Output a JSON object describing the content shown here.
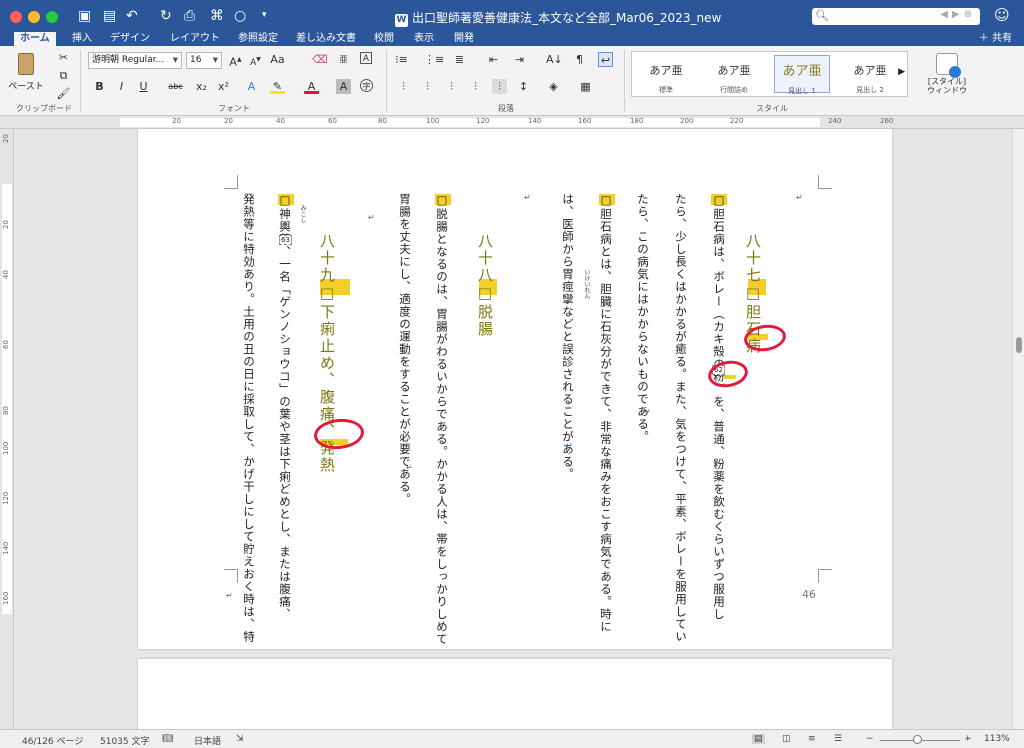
{
  "window": {
    "title": "出口聖師著愛善健康法_本文など全部_Mar06_2023_new",
    "search_placeholder": ""
  },
  "tabs": [
    "ホーム",
    "挿入",
    "デザイン",
    "レイアウト",
    "参照設定",
    "差し込み文書",
    "校閲",
    "表示",
    "開発"
  ],
  "share_label": "共有",
  "ribbon": {
    "clipboard": {
      "paste": "ペースト",
      "group": "クリップボード"
    },
    "font": {
      "name": "游明朝 Regular...",
      "size": "16",
      "group": "フォント"
    },
    "paragraph": {
      "group": "段落"
    },
    "styles": {
      "group": "スタイル",
      "items": [
        {
          "preview": "あア亜",
          "name": "標準"
        },
        {
          "preview": "あア亜",
          "name": "行間詰め"
        },
        {
          "preview": "あア亜",
          "name": "見出し 1"
        },
        {
          "preview": "あア亜",
          "name": "見出し 2"
        }
      ],
      "pane_button": "[スタイル]\nウィンドウ"
    }
  },
  "ruler": {
    "h_labels": [
      "20",
      "20",
      "40",
      "60",
      "80",
      "100",
      "120",
      "140",
      "160",
      "180",
      "200",
      "220",
      "240",
      "260"
    ],
    "v_labels": [
      "20",
      "20",
      "40",
      "60",
      "80",
      "100",
      "120",
      "140",
      "160"
    ]
  },
  "page": {
    "number": "46",
    "columns": [
      {
        "id": "h87",
        "text": "八十七□胆石病",
        "type": "heading"
      },
      {
        "id": "c1",
        "text": "□胆石病は、ボレー（カキ殻の粉）を、普通、粉薬を飲むくらいずつ服用し",
        "type": "body"
      },
      {
        "id": "c2",
        "text": "たら、少し長くはかかるが癒る。また、気をつけて、平素、ボレーを服用してい",
        "type": "body"
      },
      {
        "id": "c3",
        "text": "たら、この病気にはかからないものである。",
        "type": "body"
      },
      {
        "id": "c4",
        "text": "□胆石病とは、胆臓に石灰分ができて、非常な痛みをおこす病気である。時に",
        "type": "body"
      },
      {
        "id": "c5",
        "text": "は、医師から胃痙攣などと誤診されることがある。",
        "type": "body"
      },
      {
        "id": "h88",
        "text": "八十八□脱腸",
        "type": "heading"
      },
      {
        "id": "c6",
        "text": "□脱腸となるのは、胃腸がわるいからである。かかる人は、帯をしっかりしめて",
        "type": "body"
      },
      {
        "id": "c7",
        "text": "胃腸を丈夫にし、適度の運動をすることが必要である。",
        "type": "body"
      },
      {
        "id": "h89",
        "text": "八十九□下痢止め、腹痛、発熱",
        "type": "heading"
      },
      {
        "id": "c8",
        "text": "□神輿草、一名「ゲンノショウコ」の葉や茎は下痢どめとし、または腹痛、",
        "type": "body"
      },
      {
        "id": "c9",
        "text": "発熱等に特効あり。土用の丑の日に採取して、かげ干しにして貯えおく時は、特",
        "type": "body"
      }
    ],
    "ruby": [
      {
        "base": "胃痙攣",
        "reading": "いけいれん"
      },
      {
        "base": "神輿草",
        "reading": "みこし"
      }
    ],
    "footnote_marks": [
      "62",
      "63"
    ]
  },
  "status": {
    "page": "46/126 ページ",
    "words": "51035 文字",
    "lang": "日本語",
    "zoom": "113%"
  },
  "colors": {
    "titlebar": "#2b579a",
    "highlight": "#f4cf2a",
    "heading": "#7a7a12",
    "annotation": "#e01a3a"
  }
}
